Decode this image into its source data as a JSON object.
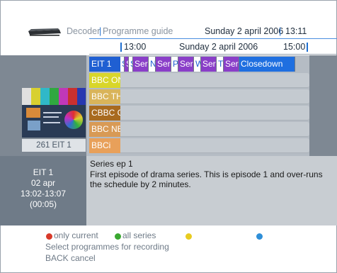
{
  "header": {
    "device": "Decoder",
    "separator": "|",
    "section": "Programme guide",
    "date": "Sunday 2 april 2006",
    "time": "13:11"
  },
  "ruler": {
    "start": "13:00",
    "date": "Sunday 2 april 2006",
    "end": "15:00"
  },
  "thumbnail": {
    "caption": "261 EIT 1"
  },
  "channels": [
    {
      "name": "EIT 1",
      "color": "#1f5fd2"
    },
    {
      "name": "BBC ON",
      "color": "#d9d62a"
    },
    {
      "name": "BBC TH",
      "color": "#d9b45a"
    },
    {
      "name": "CBBC C",
      "color": "#a86a1f"
    },
    {
      "name": "BBC NE",
      "color": "#d89a55"
    },
    {
      "name": "BBCi",
      "color": "#e8a05a"
    }
  ],
  "eit_programmes": [
    {
      "label": "S",
      "color": "#ffffff",
      "text": "#1f5fd2"
    },
    {
      "label": "S",
      "color": "#8a3ec8",
      "text": "#ffffff"
    },
    {
      "label": "S",
      "color": "#ffffff",
      "text": "#1f5fd2"
    },
    {
      "label": "Seri",
      "color": "#8a3ec8",
      "text": "#ffffff"
    },
    {
      "label": "N",
      "color": "#ffffff",
      "text": "#1f5fd2"
    },
    {
      "label": "Seri",
      "color": "#8a3ec8",
      "text": "#ffffff"
    },
    {
      "label": "P",
      "color": "#ffffff",
      "text": "#1f5fd2"
    },
    {
      "label": "Seri",
      "color": "#8a3ec8",
      "text": "#ffffff"
    },
    {
      "label": "W",
      "color": "#ffffff",
      "text": "#1f5fd2"
    },
    {
      "label": "Seri",
      "color": "#8a3ec8",
      "text": "#ffffff"
    },
    {
      "label": "Ti",
      "color": "#ffffff",
      "text": "#1f5fd2"
    },
    {
      "label": "Seri",
      "color": "#8a3ec8",
      "text": "#ffffff"
    },
    {
      "label": "Closedown",
      "color": "#1f6fe0",
      "text": "#ffffff"
    }
  ],
  "info": {
    "channel": "EIT 1",
    "date": "02 apr",
    "time": "13:02-13:07",
    "duration": "(00:05)",
    "title": "Series ep 1",
    "description": "First episode of drama series. This is episode 1 and over-runs the schedule by 2 minutes."
  },
  "footer": {
    "red_label": "only current",
    "green_label": "all series",
    "yellow_label": "",
    "blue_label": "",
    "line2": "Select programmes for recording",
    "line3": "BACK cancel",
    "colors": {
      "red": "#d83a2a",
      "green": "#3aa830",
      "yellow": "#e8cc20",
      "blue": "#2f8fd8"
    }
  }
}
